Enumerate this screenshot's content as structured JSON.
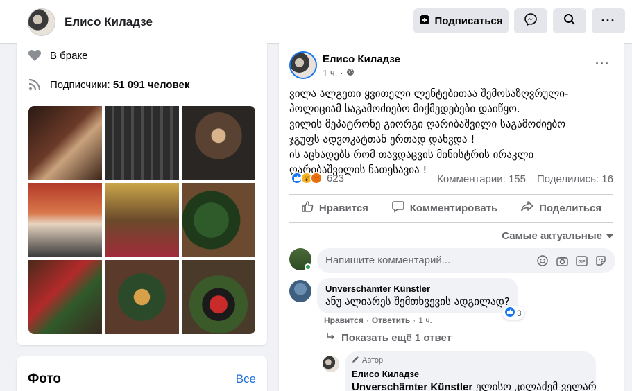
{
  "header": {
    "name": "Елисо Киладзе",
    "subscribe_label": "Подписаться"
  },
  "intro": {
    "relationship": "В браке",
    "followers_prefix": "Подписчики: ",
    "followers_count": "51 091 человек"
  },
  "photos_section": {
    "title": "Фото",
    "see_all": "Все"
  },
  "post": {
    "author": "Елисо Киладзе",
    "time": "1 ч.",
    "text_lines": [
      "ვილა ალგეთი ყვითელი ლენტებითაა შემოსაზღვრული-",
      "პოლიციამ საგამოძიებო მიქმედებები დაიწყო.",
      "ვილის მეპატრონე გიორგი ღარიბაშვილი საგამოძიებო",
      "ჯგუფს ადვოკატთან ერთად დახვდა !",
      "ის აცხადებს რომ თავდაცვის მინისტრის ირაკლი",
      "ღარიბაშვილის ნათესავია !"
    ],
    "reactions_count": "623",
    "comments": "Комментарии: 155",
    "shares": "Поделились: 16",
    "like_label": "Нравится",
    "comment_label": "Комментировать",
    "share_label": "Поделиться",
    "sort_label": "Самые актуальные",
    "comment_placeholder": "Напишите комментарий..."
  },
  "comment": {
    "author": "Unverschämter Künstler",
    "text": "ანუ ალიარეს შემთხვევის ადგილად?",
    "like": "Нравится",
    "reply": "Ответить",
    "time": "1 ч.",
    "likes": "3",
    "show_replies": "Показать ещё 1 ответ"
  },
  "reply": {
    "author_tag": "Автор",
    "author": "Елисо Киладзе",
    "mention": "Unverschämter Künstler",
    "text": " ელისო კილაძემ ველარ"
  },
  "colors": {
    "accent": "#1877f2",
    "link": "#216fdb",
    "secondary_text": "#65676b",
    "page_bg": "#f0f2f5"
  }
}
